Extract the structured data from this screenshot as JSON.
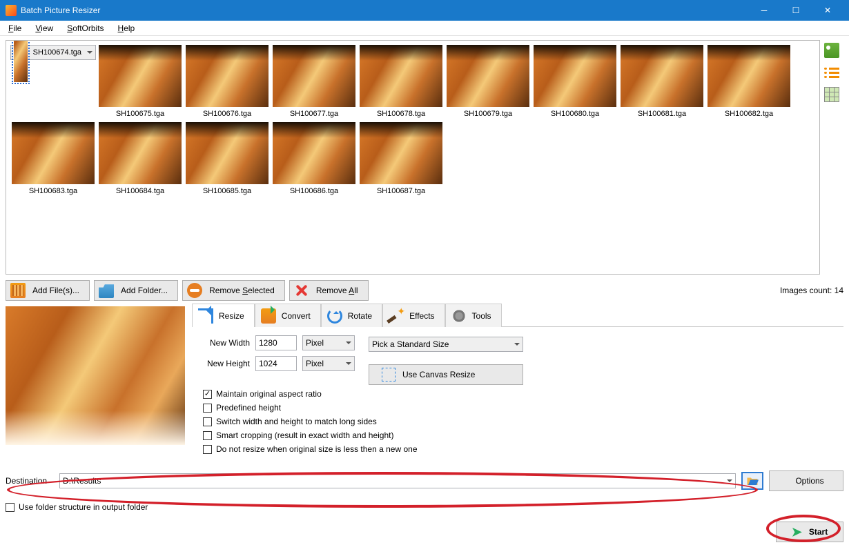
{
  "title": "Batch Picture Resizer",
  "menu": {
    "file": "File",
    "view": "View",
    "softorbits": "SoftOrbits",
    "help": "Help"
  },
  "thumbs": [
    "SH100674.tga",
    "SH100675.tga",
    "SH100676.tga",
    "SH100677.tga",
    "SH100678.tga",
    "SH100679.tga",
    "SH100680.tga",
    "SH100681.tga",
    "SH100682.tga",
    "SH100683.tga",
    "SH100684.tga",
    "SH100685.tga",
    "SH100686.tga",
    "SH100687.tga"
  ],
  "toolbar": {
    "addfile": "Add File(s)...",
    "addfolder": "Add Folder...",
    "removesel": "Remove Selected",
    "removeall": "Remove All"
  },
  "imgcount": "Images count: 14",
  "tabs": {
    "resize": "Resize",
    "convert": "Convert",
    "rotate": "Rotate",
    "effects": "Effects",
    "tools": "Tools"
  },
  "resize": {
    "newwidth_lbl": "New Width",
    "newwidth_val": "1280",
    "newheight_lbl": "New Height",
    "newheight_val": "1024",
    "unit": "Pixel",
    "stdsize": "Pick a Standard Size",
    "maintain": "Maintain original aspect ratio",
    "predef": "Predefined height",
    "switch": "Switch width and height to match long sides",
    "smartcrop": "Smart cropping (result in exact width and height)",
    "donotresize": "Do not resize when original size is less then a new one",
    "canvas": "Use Canvas Resize"
  },
  "dest": {
    "label": "Destination",
    "value": "D:\\Results"
  },
  "folderchk": "Use folder structure in output folder",
  "options": "Options",
  "start": "Start"
}
